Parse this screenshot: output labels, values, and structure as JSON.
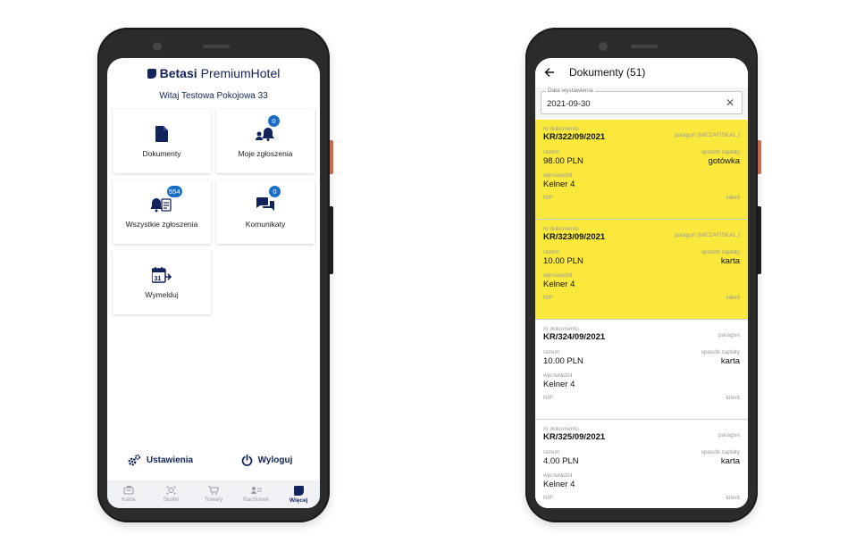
{
  "left_screen": {
    "brand_bold": "Betasi",
    "brand_light": "PremiumHotel",
    "welcome": "Witaj Testowa Pokojowa 33",
    "tiles": [
      {
        "label": "Dokumenty",
        "icon": "document-icon",
        "badge": ""
      },
      {
        "label": "Moje zgłoszenia",
        "icon": "bell-person-icon",
        "badge": "0"
      },
      {
        "label": "Wszystkie zgłoszenia",
        "icon": "bell-list-icon",
        "badge": "554"
      },
      {
        "label": "Komunikaty",
        "icon": "chat-icon",
        "badge": "0"
      },
      {
        "label": "Wymelduj",
        "icon": "calendar-checkout-icon",
        "badge": ""
      }
    ],
    "settings_label": "Ustawienia",
    "logout_label": "Wyloguj",
    "bottom_nav": [
      {
        "label": "Karta",
        "icon": "card-icon"
      },
      {
        "label": "Stoliki",
        "icon": "tables-icon"
      },
      {
        "label": "Towary",
        "icon": "cart-icon"
      },
      {
        "label": "Rachunek",
        "icon": "receipt-icon"
      },
      {
        "label": "Więcej",
        "icon": "more-icon",
        "active": true
      }
    ],
    "colors": {
      "brand": "#13235b",
      "badge": "#1a6ec8"
    }
  },
  "right_screen": {
    "title": "Dokumenty (51)",
    "date_label": "Data wystawienia",
    "date_value": "2021-09-30",
    "field_labels": {
      "doc_no": "nr dokumentu",
      "total": "razem",
      "payment": "sposób zapłaty",
      "entered_by": "wprowadził",
      "nip": "NIP",
      "client": "klient"
    },
    "documents": [
      {
        "number": "KR/322/09/2021",
        "type": "paragon (NIEZAFISKAL.)",
        "total": "98.00 PLN",
        "payment": "gotówka",
        "entered_by": "Kelner 4",
        "highlighted": true
      },
      {
        "number": "KR/323/09/2021",
        "type": "paragon (NIEZAFISKAL.)",
        "total": "10.00 PLN",
        "payment": "karta",
        "entered_by": "Kelner 4",
        "highlighted": true
      },
      {
        "number": "KR/324/09/2021",
        "type": "paragon",
        "total": "10.00 PLN",
        "payment": "karta",
        "entered_by": "Kelner 4",
        "highlighted": false
      },
      {
        "number": "KR/325/09/2021",
        "type": "paragon",
        "total": "4.00 PLN",
        "payment": "karta",
        "entered_by": "Kelner 4",
        "highlighted": false
      }
    ],
    "colors": {
      "highlight": "#fae83c"
    }
  }
}
